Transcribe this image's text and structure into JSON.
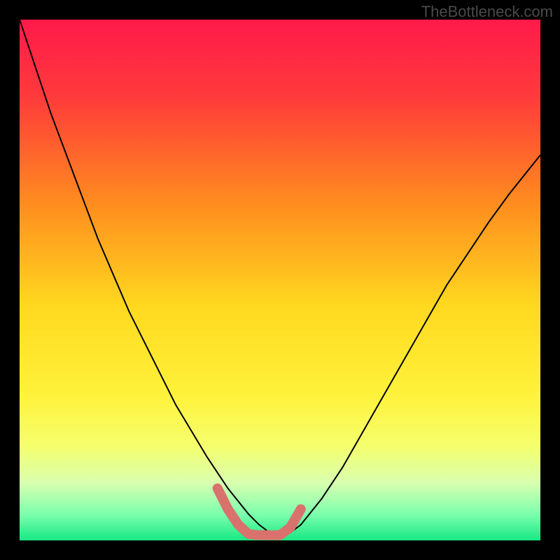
{
  "watermark": "TheBottleneck.com",
  "chart_data": {
    "type": "line",
    "title": "",
    "xlabel": "",
    "ylabel": "",
    "xlim": [
      0,
      100
    ],
    "ylim": [
      0,
      100
    ],
    "background_gradient": {
      "stops": [
        {
          "offset": 0,
          "color": "#ff1a4a"
        },
        {
          "offset": 15,
          "color": "#ff3b3b"
        },
        {
          "offset": 35,
          "color": "#ff8b1f"
        },
        {
          "offset": 55,
          "color": "#ffd91f"
        },
        {
          "offset": 72,
          "color": "#fff23a"
        },
        {
          "offset": 82,
          "color": "#f5ff6e"
        },
        {
          "offset": 89,
          "color": "#d8ffb0"
        },
        {
          "offset": 95,
          "color": "#7cffad"
        },
        {
          "offset": 100,
          "color": "#18e884"
        }
      ]
    },
    "series": [
      {
        "name": "curve",
        "color": "#000000",
        "width": 2,
        "x": [
          0,
          3,
          6,
          9,
          12,
          15,
          18,
          21,
          24,
          27,
          30,
          33,
          36,
          38,
          40,
          42,
          44,
          46,
          48,
          50,
          52,
          54,
          58,
          62,
          66,
          70,
          74,
          78,
          82,
          86,
          90,
          94,
          98,
          100
        ],
        "y": [
          100,
          91,
          82,
          74,
          66,
          58,
          51,
          44,
          38,
          32,
          26,
          21,
          16,
          13,
          10,
          7.5,
          5,
          3,
          1.5,
          1,
          1.5,
          3,
          8,
          14,
          21,
          28,
          35,
          42,
          49,
          55,
          61,
          66.5,
          71.5,
          74
        ]
      },
      {
        "name": "highlight",
        "color": "#d9716c",
        "width": 14,
        "linecap": "round",
        "x": [
          38,
          40,
          42,
          44,
          46,
          48,
          50,
          52,
          54
        ],
        "y": [
          10,
          6,
          3,
          1.2,
          1,
          1,
          1,
          2.5,
          6
        ]
      }
    ]
  }
}
